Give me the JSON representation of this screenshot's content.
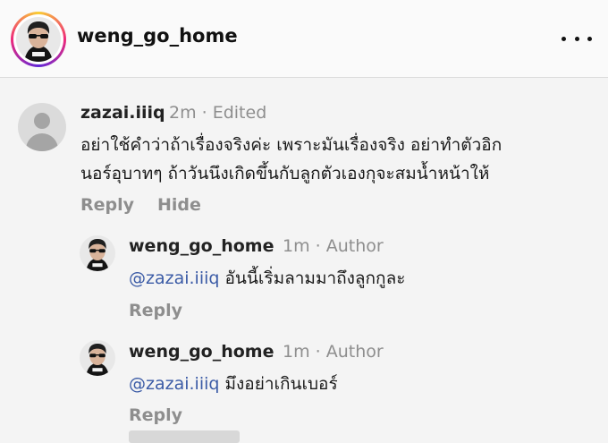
{
  "header": {
    "username": "weng_go_home",
    "avatar_icon": "profile-photo-sunglasses",
    "more_icon": "more-horizontal-icon"
  },
  "comment": {
    "username": "zazai.iiiq",
    "meta": "2m · Edited",
    "text_line1": "อย่าใช้คำว่าถ้าเรื่องจริงค่ะ เพราะมันเรื่องจริง อย่าทำตัวอิก",
    "text_line2": "นอร์อุบาทๆ ถ้าวันนึงเกิดขึ้นกับลูกตัวเองกุจะสมน้ำหน้าให้",
    "reply_label": "Reply",
    "hide_label": "Hide"
  },
  "replies": [
    {
      "username": "weng_go_home",
      "meta": "1m · Author",
      "mention": "@zazai.iiiq",
      "text": " อันนี้เริ่มลามมาถึงลูกกูละ",
      "reply_label": "Reply"
    },
    {
      "username": "weng_go_home",
      "meta": "1m · Author",
      "mention": "@zazai.iiiq",
      "text": " มึงอย่าเกินเบอร์",
      "reply_label": "Reply"
    }
  ],
  "colors": {
    "mention": "#3b5ba6",
    "meta": "#8e8e8e",
    "background": "#f4f4f4"
  }
}
